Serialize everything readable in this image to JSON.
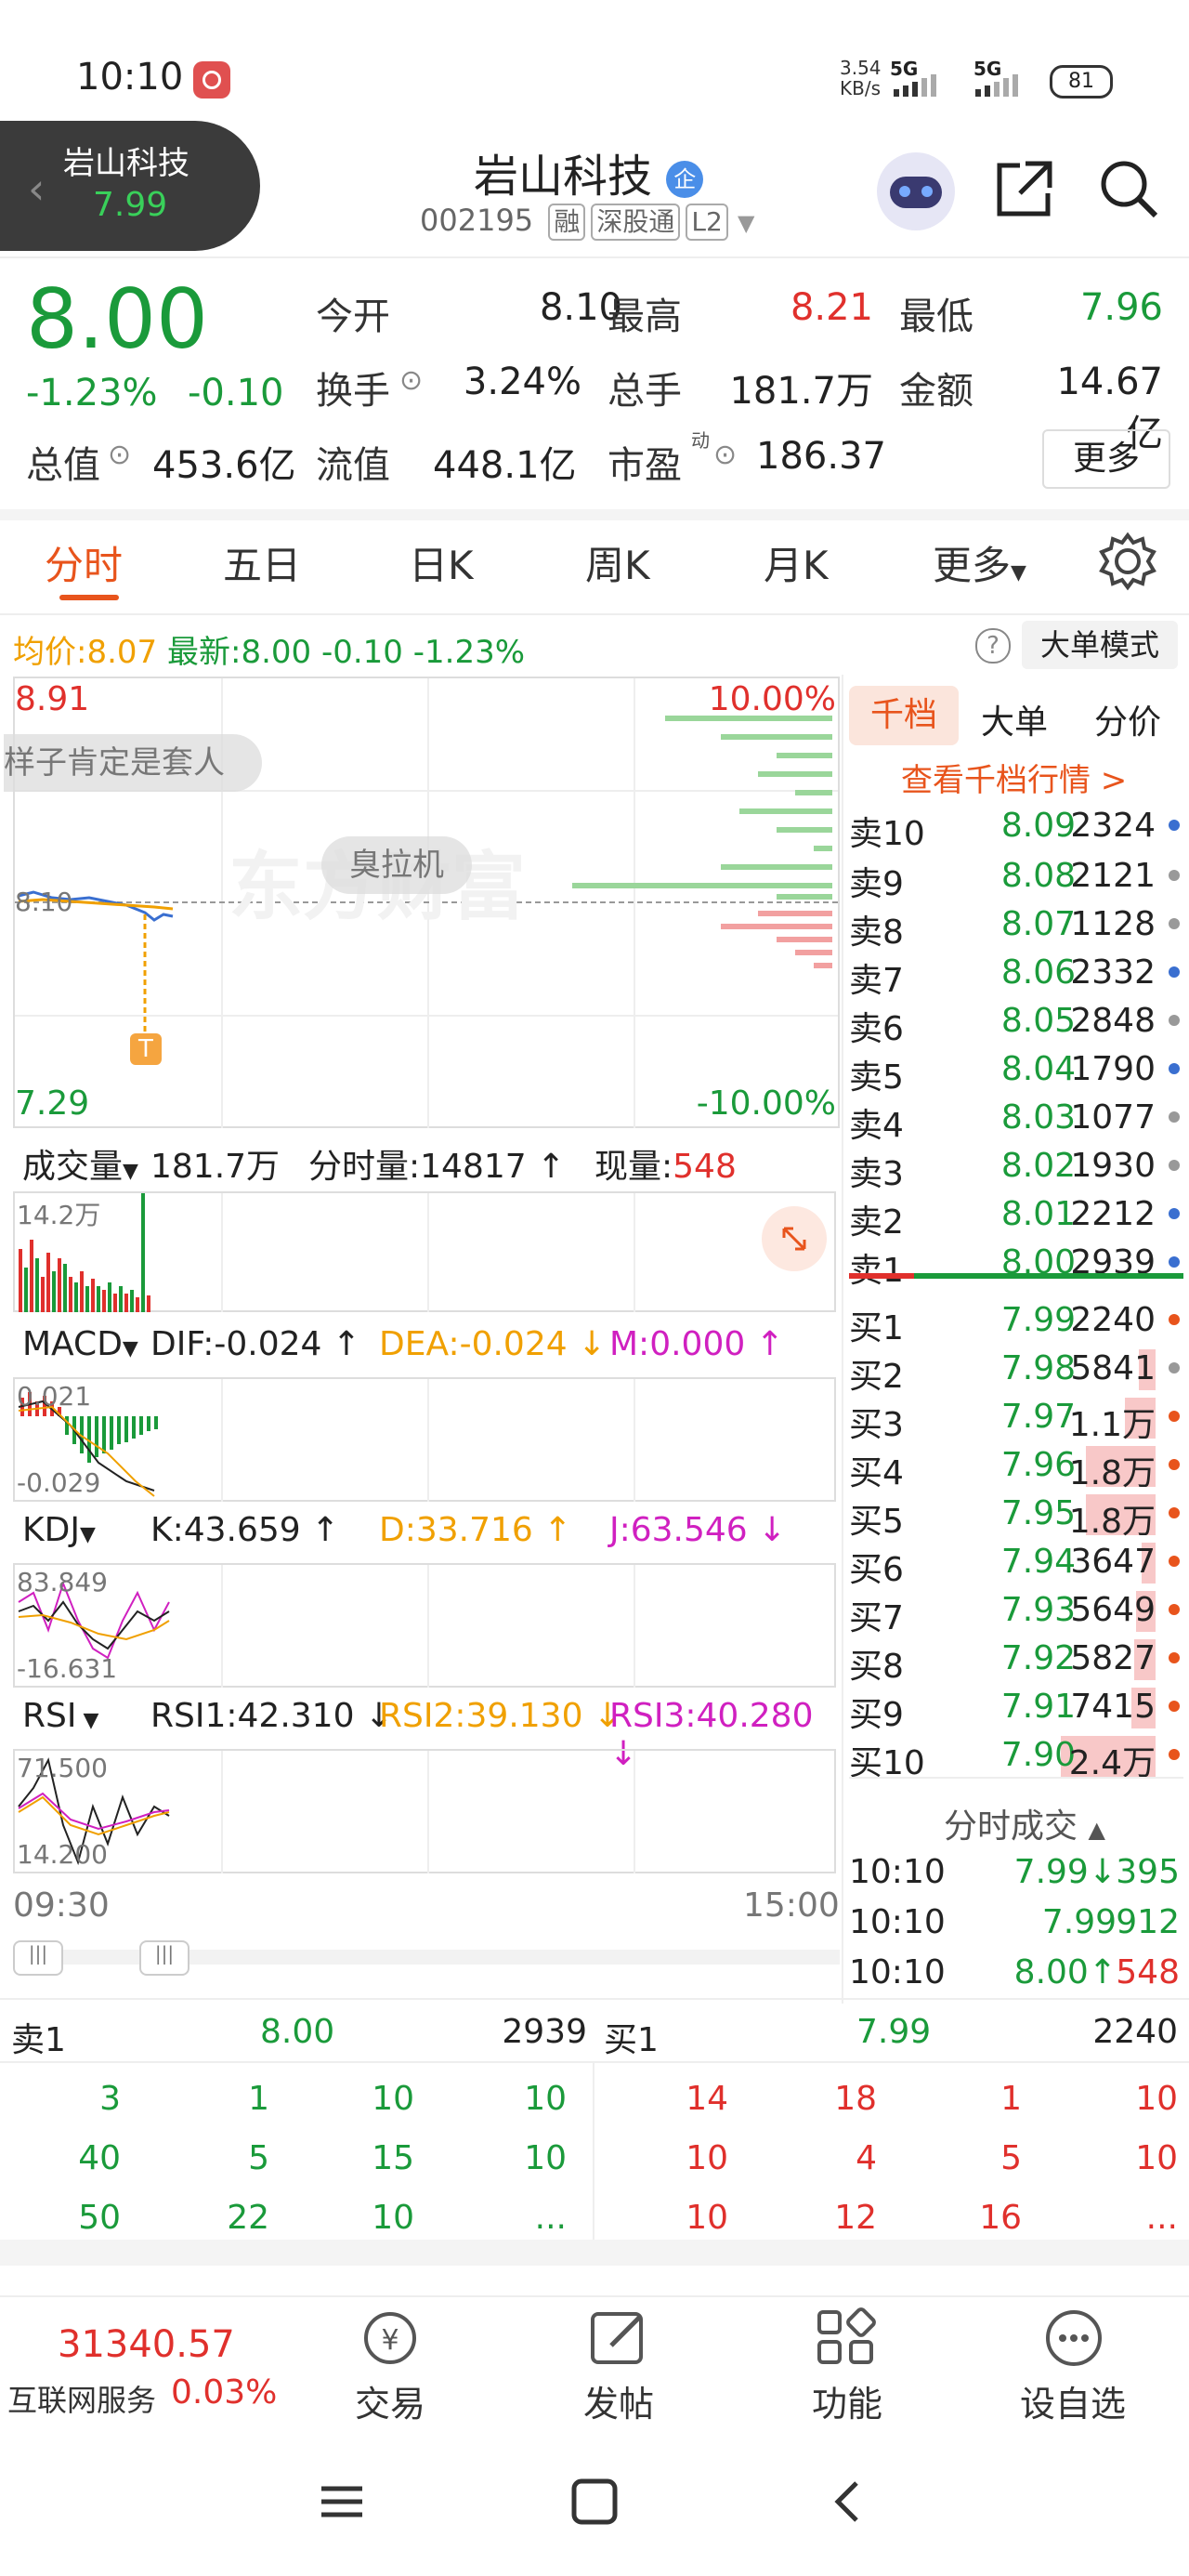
{
  "status_bar": {
    "time": "10:10",
    "speed_top": "3.54",
    "speed_unit": "KB/s",
    "net1": "5G",
    "net2": "5G",
    "battery": "81"
  },
  "header": {
    "chip_name": "岩山科技",
    "chip_price": "7.99",
    "title": "岩山科技",
    "title_badge": "企",
    "code": "002195",
    "tags": [
      "融",
      "深股通",
      "L2"
    ]
  },
  "quote": {
    "price": "8.00",
    "change_pct": "-1.23%",
    "change": "-0.10",
    "open_label": "今开",
    "open": "8.10",
    "high_label": "最高",
    "high": "8.21",
    "low_label": "最低",
    "low": "7.96",
    "turnover_label": "换手",
    "turnover": "3.24%",
    "volume_label": "总手",
    "volume": "181.7万",
    "amount_label": "金额",
    "amount": "14.67亿",
    "mktcap_label": "总值",
    "mktcap": "453.6亿",
    "float_label": "流值",
    "float": "448.1亿",
    "pe_label": "市盈",
    "pe_sup": "动",
    "pe": "186.37",
    "more_button": "更多"
  },
  "tabs": [
    "分时",
    "五日",
    "日K",
    "周K",
    "月K",
    "更多"
  ],
  "chart_info": {
    "avg_label": "均价:",
    "avg": "8.07",
    "latest_label": "最新:",
    "latest": "8.00",
    "chg": "-0.10",
    "pct": "-1.23%",
    "mode_button": "大单模式",
    "top_price": "8.91",
    "top_pct": "10.00%",
    "bottom_price": "7.29",
    "bottom_pct": "-10.00%",
    "mid_price": "8.10",
    "marker": "T",
    "comment": "样子肯定是套人",
    "comment2": "臭拉机",
    "watermark": "东方财富",
    "time_start": "09:30",
    "time_end": "15:00"
  },
  "volume_panel": {
    "label": "成交量",
    "total": "181.7万",
    "min_label": "分时量:",
    "min_val": "14817",
    "now_label": "现量:",
    "now_val": "548",
    "scale": "14.2万"
  },
  "macd": {
    "label": "MACD",
    "dif": "DIF:-0.024",
    "dea": "DEA:-0.024",
    "m": "M:0.000",
    "top": "0.021",
    "bottom": "-0.029"
  },
  "kdj": {
    "label": "KDJ",
    "k": "K:43.659",
    "d": "D:33.716",
    "j": "J:63.546",
    "top": "83.849",
    "bottom": "-16.631"
  },
  "rsi": {
    "label": "RSI",
    "r1": "RSI1:42.310",
    "r2": "RSI2:39.130",
    "r3": "RSI3:40.280",
    "top": "71.500",
    "bottom": "14.200"
  },
  "orderbook_tabs": [
    "千档",
    "大单",
    "分价"
  ],
  "orderbook_link": "查看千档行情 >",
  "asks": [
    {
      "label": "卖10",
      "price": "8.09",
      "vol": "2324",
      "dot": "#3a6fd0",
      "bar": 0
    },
    {
      "label": "卖9",
      "price": "8.08",
      "vol": "2121",
      "dot": "#999",
      "bar": 0
    },
    {
      "label": "卖8",
      "price": "8.07",
      "vol": "1128",
      "dot": "#999",
      "bar": 0
    },
    {
      "label": "卖7",
      "price": "8.06",
      "vol": "2332",
      "dot": "#3a6fd0",
      "bar": 0
    },
    {
      "label": "卖6",
      "price": "8.05",
      "vol": "2848",
      "dot": "#999",
      "bar": 0
    },
    {
      "label": "卖5",
      "price": "8.04",
      "vol": "1790",
      "dot": "#3a6fd0",
      "bar": 0
    },
    {
      "label": "卖4",
      "price": "8.03",
      "vol": "1077",
      "dot": "#999",
      "bar": 0
    },
    {
      "label": "卖3",
      "price": "8.02",
      "vol": "1930",
      "dot": "#999",
      "bar": 0
    },
    {
      "label": "卖2",
      "price": "8.01",
      "vol": "2212",
      "dot": "#3a6fd0",
      "bar": 0
    },
    {
      "label": "卖1",
      "price": "8.00",
      "vol": "2939",
      "dot": "#3a6fd0",
      "bar": 0
    }
  ],
  "bids": [
    {
      "label": "买1",
      "price": "7.99",
      "vol": "2240",
      "dot": "#e8541c",
      "bar": 0
    },
    {
      "label": "买2",
      "price": "7.98",
      "vol": "5841",
      "dot": "#999",
      "bar": 0.12
    },
    {
      "label": "买3",
      "price": "7.97",
      "vol": "1.1万",
      "dot": "#e8541c",
      "bar": 0.22
    },
    {
      "label": "买4",
      "price": "7.96",
      "vol": "1.8万",
      "dot": "#e8541c",
      "bar": 0.5
    },
    {
      "label": "买5",
      "price": "7.95",
      "vol": "1.8万",
      "dot": "#e8541c",
      "bar": 0.5
    },
    {
      "label": "买6",
      "price": "7.94",
      "vol": "3647",
      "dot": "#e8541c",
      "bar": 0.1
    },
    {
      "label": "买7",
      "price": "7.93",
      "vol": "5649",
      "dot": "#e8541c",
      "bar": 0.14
    },
    {
      "label": "买8",
      "price": "7.92",
      "vol": "5827",
      "dot": "#e8541c",
      "bar": 0.15
    },
    {
      "label": "买9",
      "price": "7.91",
      "vol": "7415",
      "dot": "#e8541c",
      "bar": 0.17
    },
    {
      "label": "买10",
      "price": "7.90",
      "vol": "2.4万",
      "dot": "#e8541c",
      "bar": 0.68
    }
  ],
  "trades_title": "分时成交",
  "trades": [
    {
      "time": "10:10",
      "price": "7.99",
      "arrow": "↓",
      "vol": "395",
      "pc": "green",
      "vc": "green"
    },
    {
      "time": "10:10",
      "price": "7.99",
      "arrow": "",
      "vol": "912",
      "pc": "green",
      "vc": "green"
    },
    {
      "time": "10:10",
      "price": "8.00",
      "arrow": "↑",
      "vol": "548",
      "pc": "green",
      "vc": "red"
    }
  ],
  "bottom_queue": {
    "ask_label": "卖1",
    "ask_price": "8.00",
    "ask_vol": "2939",
    "bid_label": "买1",
    "bid_price": "7.99",
    "bid_vol": "2240",
    "ask_rows": [
      [
        "3",
        "1",
        "10",
        "10"
      ],
      [
        "40",
        "5",
        "15",
        "10"
      ],
      [
        "50",
        "22",
        "10",
        "..."
      ]
    ],
    "bid_rows": [
      [
        "14",
        "18",
        "1",
        "10"
      ],
      [
        "10",
        "4",
        "5",
        "10"
      ],
      [
        "10",
        "12",
        "16",
        "..."
      ]
    ]
  },
  "bottom_nav": {
    "index_val": "31340.57",
    "index_name": "互联网服务",
    "index_pct": "0.03%",
    "items": [
      "交易",
      "发帖",
      "功能",
      "设自选"
    ]
  }
}
